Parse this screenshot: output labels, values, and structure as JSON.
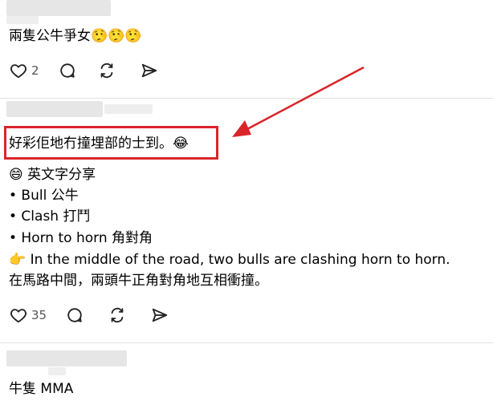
{
  "posts": [
    {
      "text": "兩隻公牛爭女🤥🤥🤥",
      "actions": {
        "like_count": "2"
      }
    },
    {
      "highlighted_line": "好彩佢地冇撞埋部的士到。😂",
      "lines": [
        "😄 英文字分享",
        "• Bull 公牛",
        "• Clash 打鬥",
        "• Horn to horn 角對角",
        "👉 In the middle of the road, two bulls are clashing horn to horn.",
        "在馬路中間，兩頭牛正角對角地互相衝撞。"
      ],
      "actions": {
        "like_count": "35"
      }
    },
    {
      "text": "牛隻 MMA"
    }
  ],
  "annotation": {
    "color": "#d9252a"
  },
  "icons": [
    "heart-icon",
    "comment-icon",
    "repost-icon",
    "share-icon"
  ]
}
